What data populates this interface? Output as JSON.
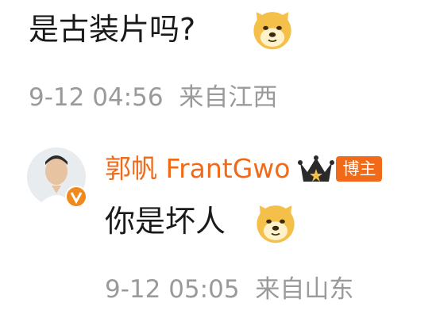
{
  "comment": {
    "text": "是古装片吗?",
    "emoji": "doge-icon",
    "time": "9-12 04:56",
    "location": "来自江西"
  },
  "reply": {
    "author": "郭帆 FrantGwo",
    "author_badge": "博主",
    "text": "你是坏人",
    "emoji": "doge-icon",
    "time": "9-12 05:05",
    "location": "来自山东",
    "colors": {
      "name": "#f06a1a",
      "badge_bg": "#f06a1a",
      "verified": "#f08a1d"
    }
  }
}
